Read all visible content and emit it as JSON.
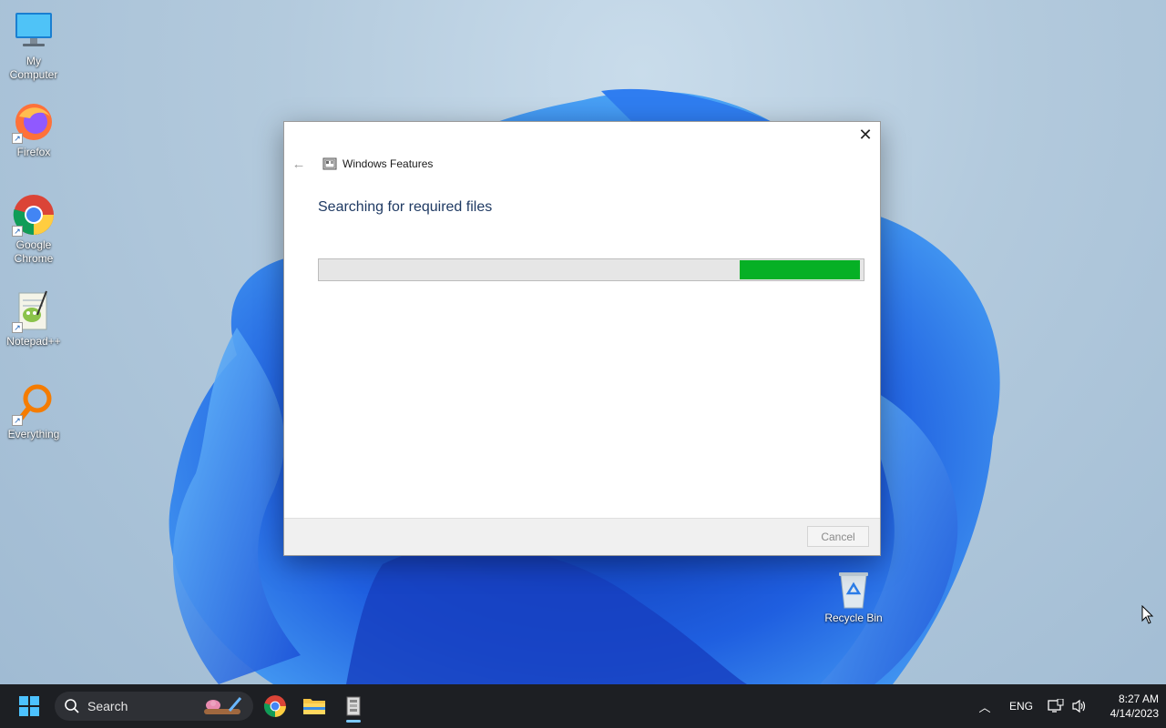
{
  "desktop": {
    "icons": [
      {
        "label_line1": "My",
        "label_line2": "Computer",
        "icon": "computer-icon"
      },
      {
        "label_line1": "Firefox",
        "label_line2": "",
        "icon": "firefox-icon"
      },
      {
        "label_line1": "Google",
        "label_line2": "Chrome",
        "icon": "chrome-icon"
      },
      {
        "label_line1": "Notepad++",
        "label_line2": "",
        "icon": "notepadpp-icon"
      },
      {
        "label_line1": "Everything",
        "label_line2": "",
        "icon": "everything-icon"
      }
    ],
    "recycle_bin": {
      "label": "Recycle Bin",
      "icon": "recycle-bin-icon"
    }
  },
  "dialog": {
    "title": "Windows Features",
    "heading": "Searching for required files",
    "progress_fraction": 0.22,
    "progress_color": "#06b025",
    "cancel_label": "Cancel",
    "close_glyph": "✕",
    "back_glyph": "←"
  },
  "taskbar": {
    "search_placeholder": "Search",
    "pinned": [
      "start-icon",
      "chrome-icon",
      "file-explorer-icon",
      "windows-features-icon"
    ],
    "language": "ENG",
    "time": "8:27 AM",
    "date": "4/14/2023"
  }
}
